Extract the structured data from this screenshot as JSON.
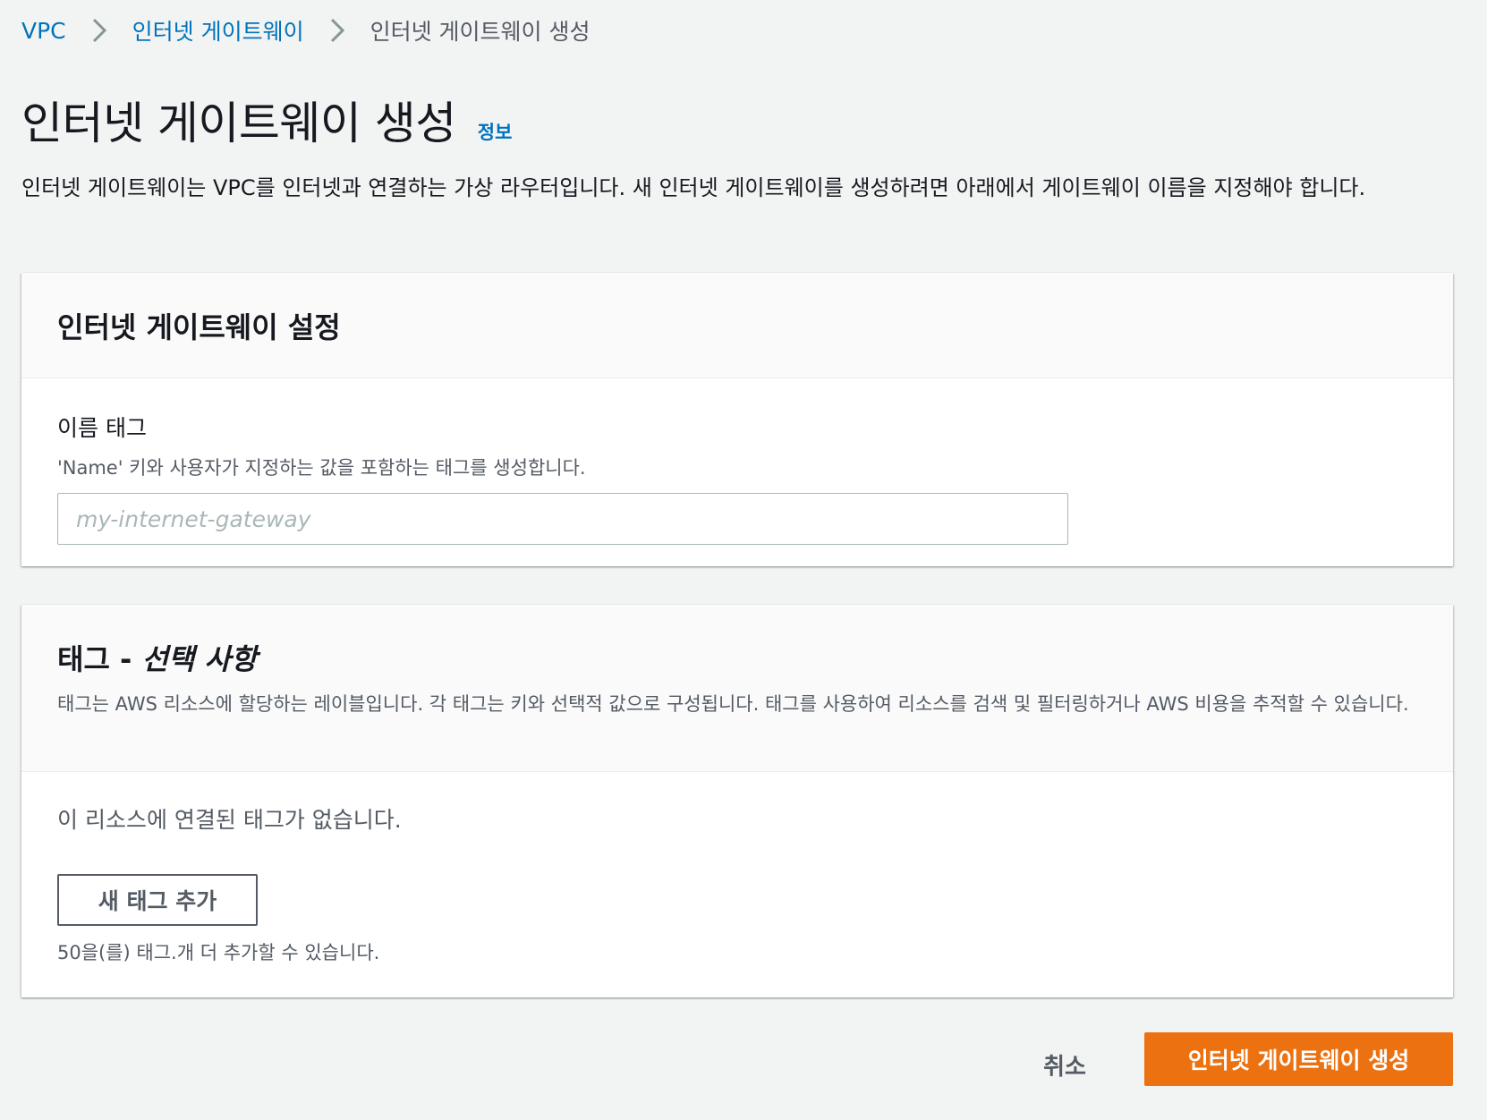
{
  "breadcrumb": {
    "items": [
      "VPC",
      "인터넷 게이트웨이"
    ],
    "current": "인터넷 게이트웨이 생성"
  },
  "header": {
    "title": "인터넷 게이트웨이 생성",
    "info_link": "정보",
    "description": "인터넷 게이트웨이는 VPC를 인터넷과 연결하는 가상 라우터입니다. 새 인터넷 게이트웨이를 생성하려면 아래에서 게이트웨이 이름을 지정해야 합니다."
  },
  "settings_panel": {
    "title": "인터넷 게이트웨이 설정",
    "name_tag": {
      "label": "이름 태그",
      "description": "'Name' 키와 사용자가 지정하는 값을 포함하는 태그를 생성합니다.",
      "value": "",
      "placeholder": "my-internet-gateway"
    }
  },
  "tags_panel": {
    "title_prefix": "태그 - ",
    "title_optional": "선택 사항",
    "description": "태그는 AWS 리소스에 할당하는 레이블입니다. 각 태그는 키와 선택적 값으로 구성됩니다. 태그를 사용하여 리소스를 검색 및 필터링하거나 AWS 비용을 추적할 수 있습니다.",
    "empty_message": "이 리소스에 연결된 태그가 없습니다.",
    "add_button": "새 태그 추가",
    "remaining": "50을(를) 태그.개 더 추가할 수 있습니다."
  },
  "actions": {
    "cancel": "취소",
    "submit": "인터넷 게이트웨이 생성"
  },
  "colors": {
    "link": "#0073bb",
    "primary": "#ec7211",
    "background": "#f2f3f3",
    "secondary_text": "#545b64"
  },
  "icons": {
    "breadcrumb_separator": "chevron-right-icon"
  }
}
